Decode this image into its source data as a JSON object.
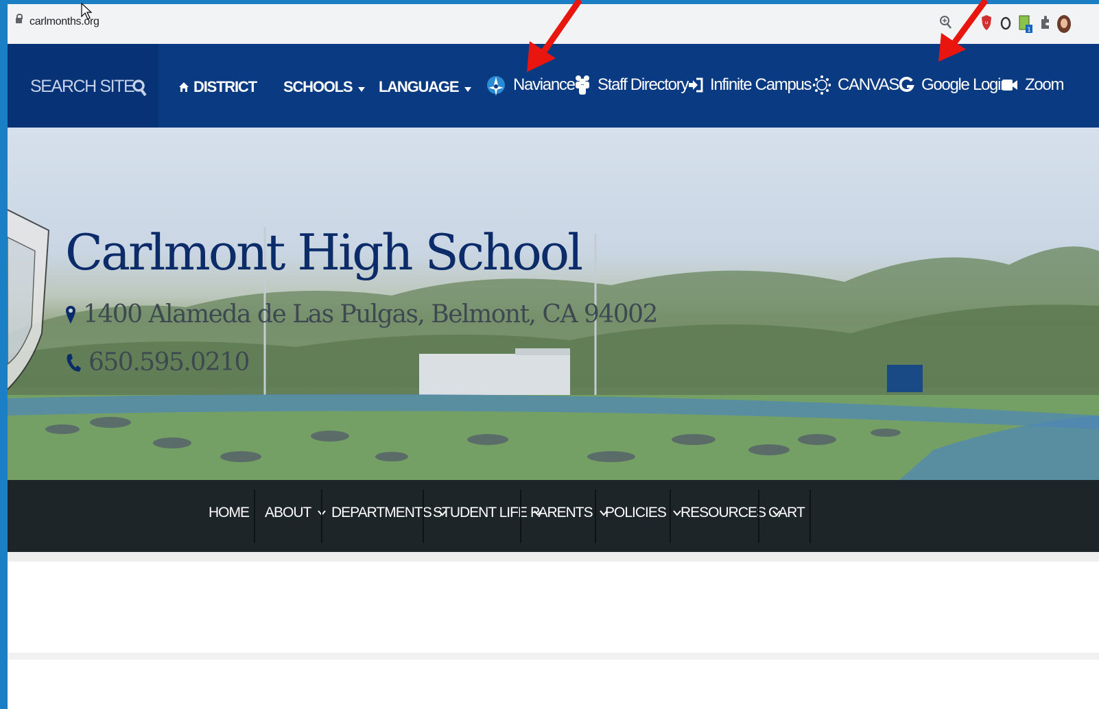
{
  "browser": {
    "url": "carlmonths.org"
  },
  "topnav": {
    "search_label": "SEARCH SITE",
    "items": [
      {
        "label": "DISTRICT",
        "icon": "home-icon"
      },
      {
        "label": "SCHOOLS",
        "icon": "caret-down-icon"
      },
      {
        "label": "LANGUAGE",
        "icon": "caret-down-icon"
      }
    ],
    "quick_links": [
      {
        "label": "Naviance",
        "icon": "compass-icon"
      },
      {
        "label": "Staff Directory",
        "icon": "people-icon"
      },
      {
        "label": "Infinite Campus",
        "icon": "sign-in-icon"
      },
      {
        "label": "CANVAS",
        "icon": "canvas-icon"
      },
      {
        "label": "Google Login",
        "icon": "google-icon"
      },
      {
        "label": "Zoom",
        "icon": "video-icon"
      }
    ]
  },
  "hero": {
    "title": "Carlmont High School",
    "address": "1400 Alameda de Las Pulgas, Belmont, CA 94002",
    "phone": "650.595.0210"
  },
  "subnav": {
    "items": [
      {
        "label": "HOME",
        "dropdown": false
      },
      {
        "label": "ABOUT",
        "dropdown": true
      },
      {
        "label": "DEPARTMENTS",
        "dropdown": true
      },
      {
        "label": "STUDENT LIFE",
        "dropdown": true
      },
      {
        "label": "PARENTS",
        "dropdown": true
      },
      {
        "label": "POLICIES",
        "dropdown": true
      },
      {
        "label": "RESOURCES",
        "dropdown": true
      },
      {
        "label": "CART",
        "dropdown": false
      }
    ]
  },
  "colors": {
    "frame_border": "#1b7fc6",
    "topnav_bg": "#0a3a82",
    "search_bg": "#083276",
    "subnav_bg": "#1d2528",
    "title_color": "#0b2b69",
    "annotation_arrow": "#e8160f"
  }
}
